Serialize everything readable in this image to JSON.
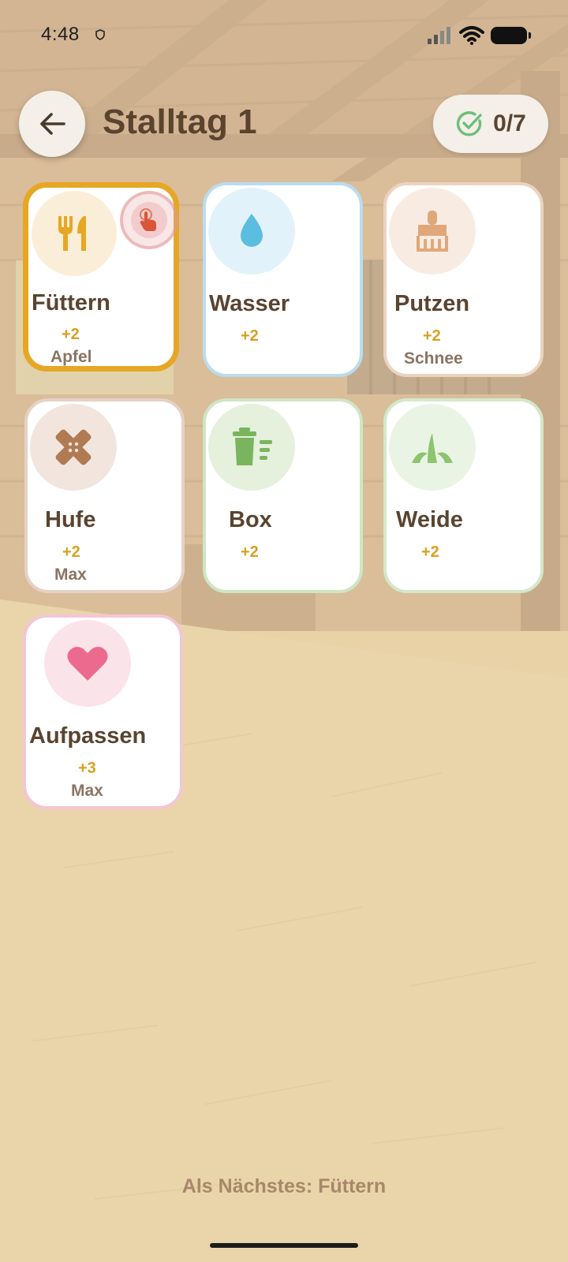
{
  "status_bar": {
    "time": "4:48"
  },
  "header": {
    "title": "Stalltag 1",
    "progress": "0/7",
    "back_icon": "arrow-left-icon",
    "progress_icon": "check-circle-icon"
  },
  "tasks": [
    {
      "id": "fuettern",
      "name": "Füttern",
      "points": "+2",
      "helper": "Apfel",
      "icon": "fork-knife-icon",
      "accent": "#e6a724",
      "icon_bg": "#fbeed8",
      "active": true
    },
    {
      "id": "wasser",
      "name": "Wasser",
      "points": "+2",
      "helper": "",
      "icon": "water-drop-icon",
      "accent": "#b9dcf0",
      "icon_bg": "#e2f2fa"
    },
    {
      "id": "putzen",
      "name": "Putzen",
      "points": "+2",
      "helper": "Schnee",
      "icon": "brush-icon",
      "accent": "#ecd3c0",
      "icon_bg": "#f8ece2"
    },
    {
      "id": "hufe",
      "name": "Hufe",
      "points": "+2",
      "helper": "Max",
      "icon": "bandage-icon",
      "accent": "#e5d1c4",
      "icon_bg": "#f1e5de"
    },
    {
      "id": "box",
      "name": "Box",
      "points": "+2",
      "helper": "",
      "icon": "trash-bin-icon",
      "accent": "#cfe5c4",
      "icon_bg": "#e5f0dd"
    },
    {
      "id": "weide",
      "name": "Weide",
      "points": "+2",
      "helper": "",
      "icon": "grass-icon",
      "accent": "#d4e8c8",
      "icon_bg": "#eaf4e4"
    },
    {
      "id": "aufpassen",
      "name": "Aufpassen",
      "points": "+3",
      "helper": "Max",
      "icon": "heart-icon",
      "accent": "#f3c6d4",
      "icon_bg": "#fbe3ea"
    }
  ],
  "footer": {
    "next_label": "Als Nächstes: Füttern"
  },
  "colors": {
    "title": "#5a4430",
    "points": "#d9a021",
    "check_green": "#6cbf7a"
  }
}
